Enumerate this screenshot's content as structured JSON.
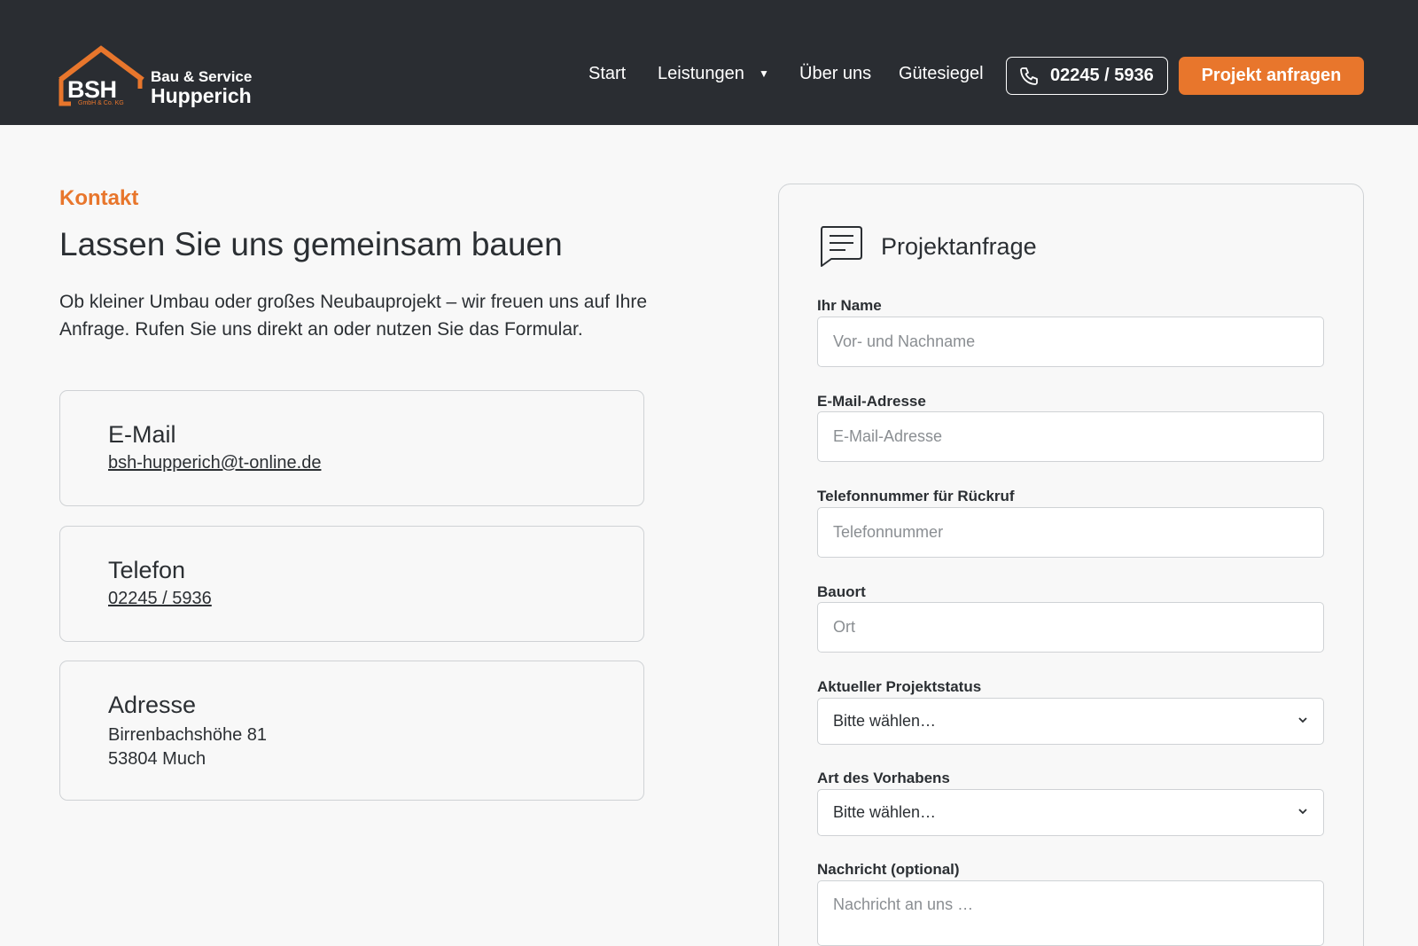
{
  "brand": {
    "logo_abbr": "BSH",
    "logo_sub": "GmbH & Co. KG",
    "line1": "Bau & Service",
    "line2": "Hupperich",
    "accent_color": "#e8762c",
    "header_bg": "#2a2d32"
  },
  "nav": {
    "start": "Start",
    "leistungen": "Leistungen",
    "ueber_uns": "Über uns",
    "guetesiegel": "Gütesiegel",
    "phone": "02245 / 5936",
    "cta": "Projekt anfragen"
  },
  "contact": {
    "eyebrow": "Kontakt",
    "heading": "Lassen Sie uns gemeinsam bauen",
    "intro": "Ob kleiner Umbau oder großes Neubauprojekt – wir freuen uns auf Ihre Anfrage. Rufen Sie uns direkt an oder nutzen Sie das Formular.",
    "email_title": "E-Mail",
    "email_value": "bsh-hupperich@t-online.de",
    "phone_title": "Telefon",
    "phone_value": "02245 / 5936",
    "address_title": "Adresse",
    "address_street": "Birrenbachshöhe 81",
    "address_city": "53804 Much"
  },
  "form": {
    "title": "Projektanfrage",
    "name_label": "Ihr Name",
    "name_placeholder": "Vor- und Nachname",
    "email_label": "E-Mail-Adresse",
    "email_placeholder": "E-Mail-Adresse",
    "phone_label": "Telefonnummer für Rückruf",
    "phone_placeholder": "Telefonnummer",
    "location_label": "Bauort",
    "location_placeholder": "Ort",
    "status_label": "Aktueller Projektstatus",
    "status_value": "Bitte wählen…",
    "type_label": "Art des Vorhabens",
    "type_value": "Bitte wählen…",
    "message_label": "Nachricht (optional)",
    "message_placeholder": "Nachricht an uns …"
  }
}
